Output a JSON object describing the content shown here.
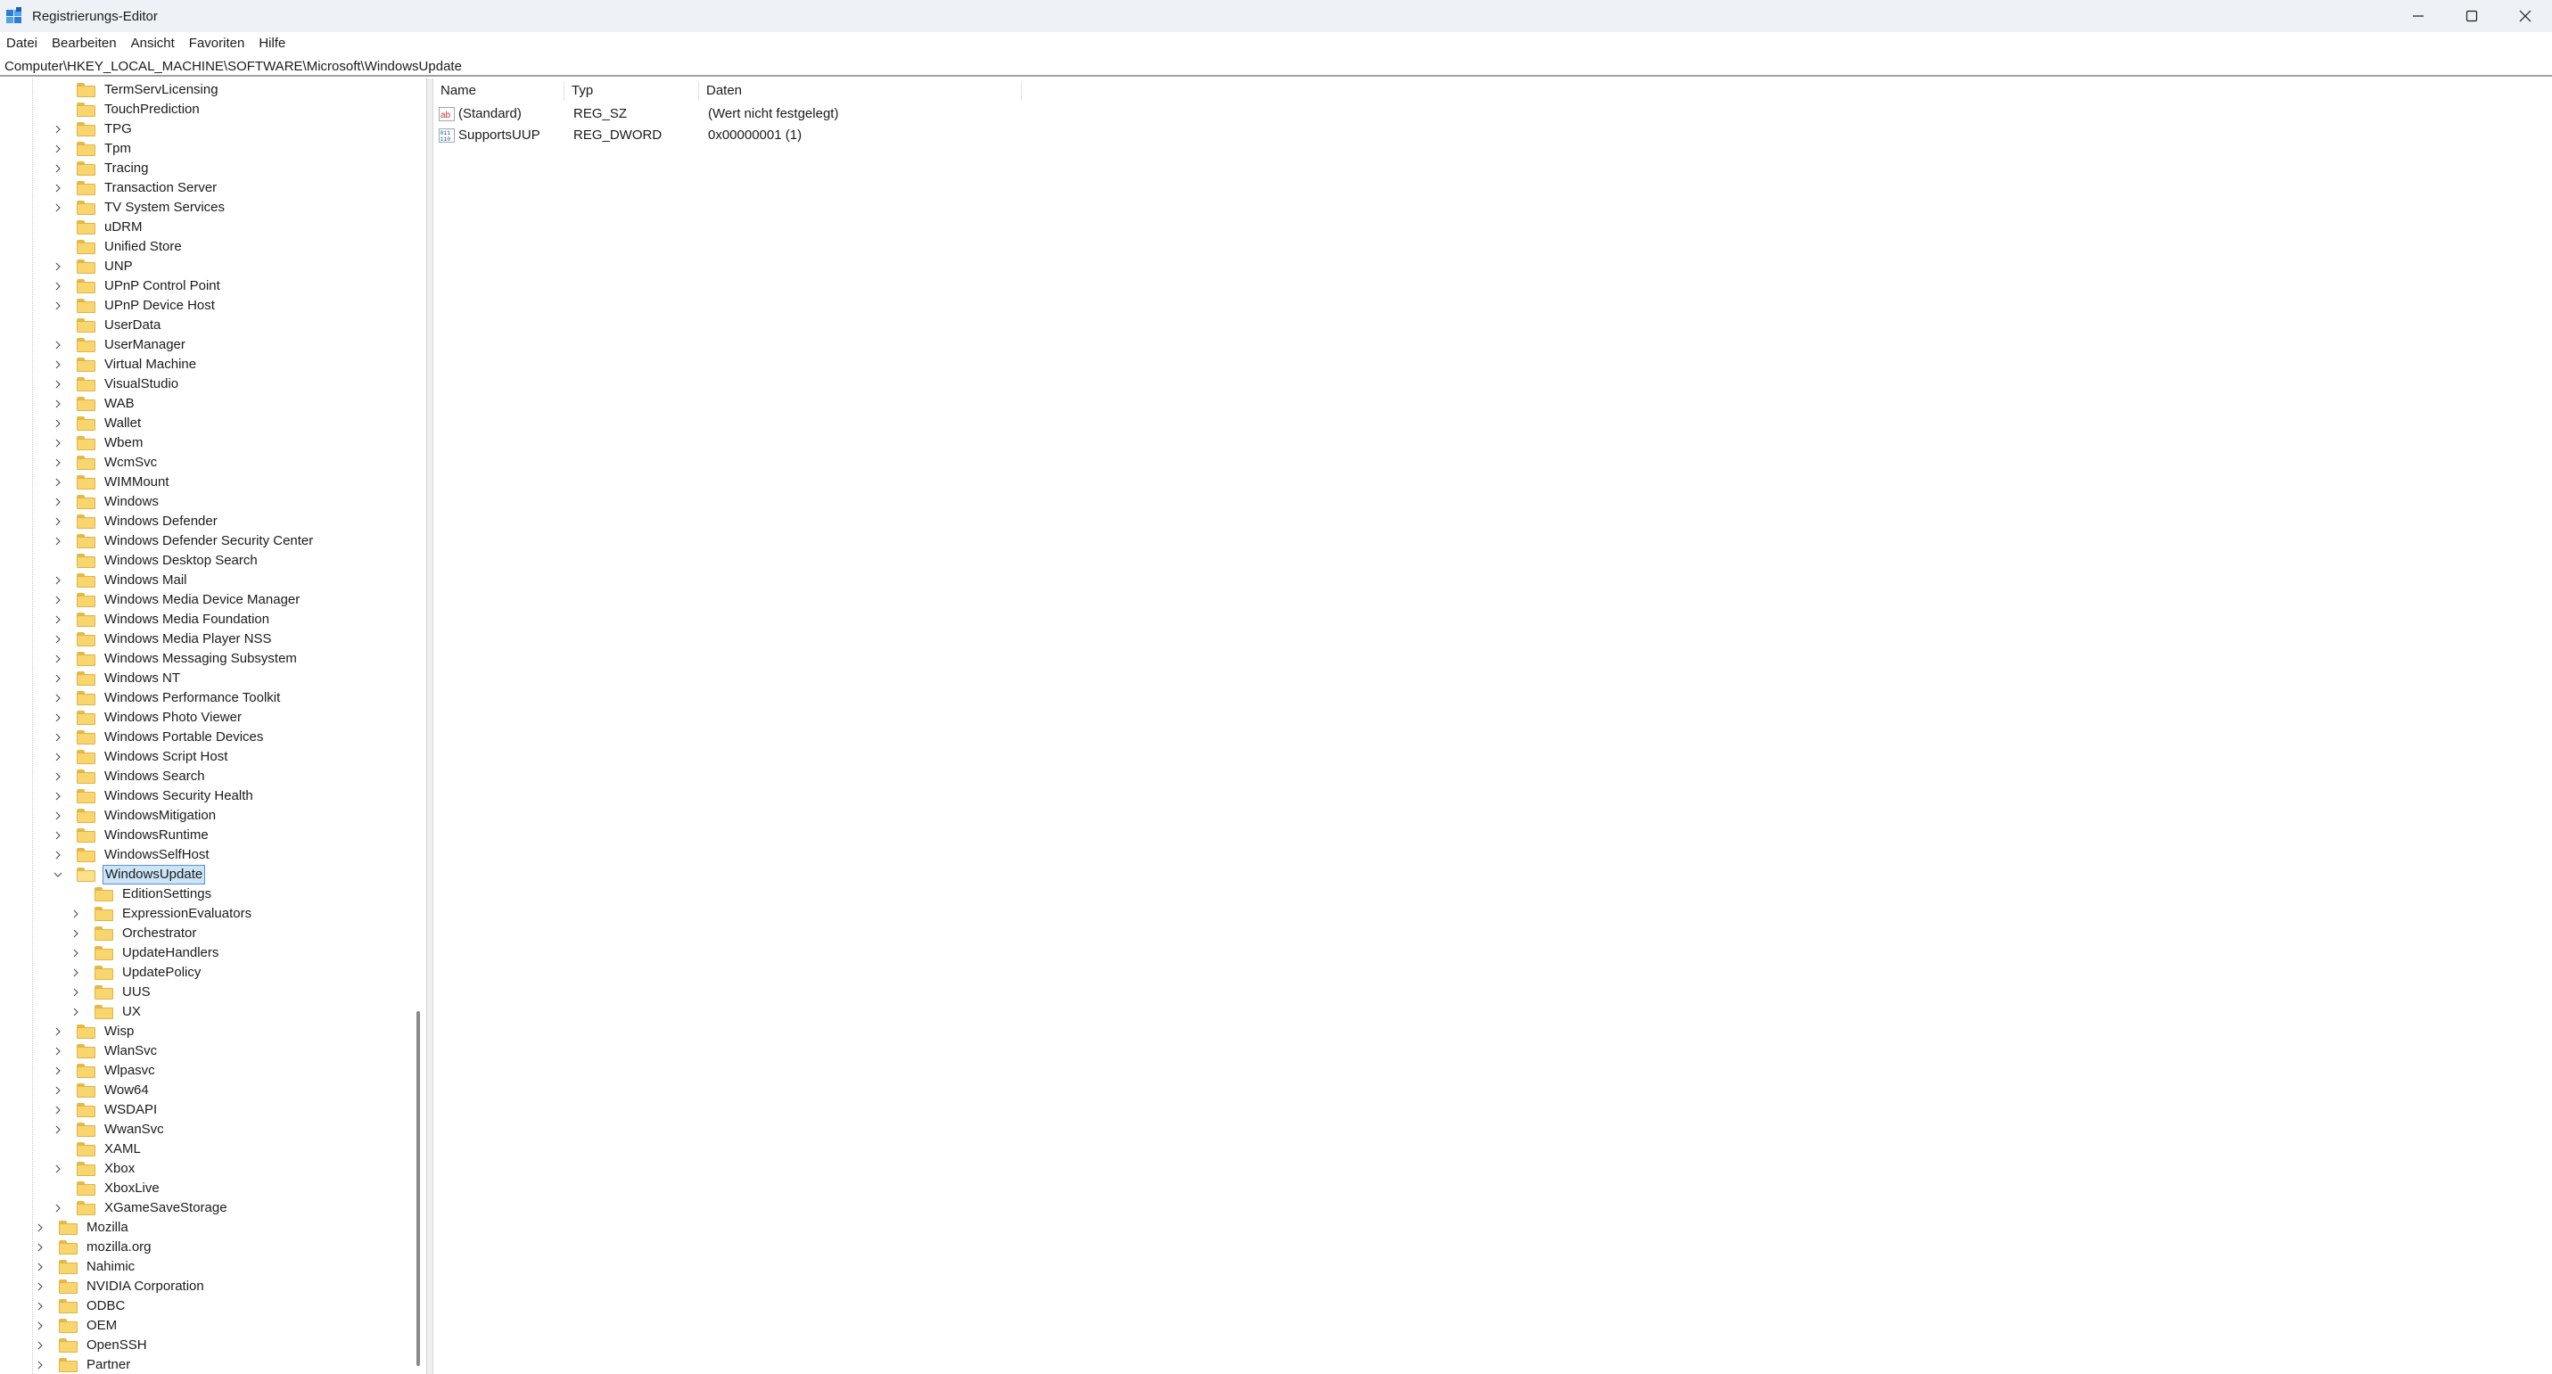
{
  "window": {
    "title": "Registrierungs-Editor",
    "controls": [
      "minimize-icon",
      "maximize-icon",
      "close-icon"
    ]
  },
  "menu": [
    "Datei",
    "Bearbeiten",
    "Ansicht",
    "Favoriten",
    "Hilfe"
  ],
  "address": "Computer\\HKEY_LOCAL_MACHINE\\SOFTWARE\\Microsoft\\WindowsUpdate",
  "tree": [
    {
      "label": "TermServLicensing",
      "depth": 1,
      "exp": false
    },
    {
      "label": "TouchPrediction",
      "depth": 1,
      "exp": false
    },
    {
      "label": "TPG",
      "depth": 1,
      "exp": true
    },
    {
      "label": "Tpm",
      "depth": 1,
      "exp": true
    },
    {
      "label": "Tracing",
      "depth": 1,
      "exp": true
    },
    {
      "label": "Transaction Server",
      "depth": 1,
      "exp": true
    },
    {
      "label": "TV System Services",
      "depth": 1,
      "exp": true
    },
    {
      "label": "uDRM",
      "depth": 1,
      "exp": false
    },
    {
      "label": "Unified Store",
      "depth": 1,
      "exp": false
    },
    {
      "label": "UNP",
      "depth": 1,
      "exp": true
    },
    {
      "label": "UPnP Control Point",
      "depth": 1,
      "exp": true
    },
    {
      "label": "UPnP Device Host",
      "depth": 1,
      "exp": true
    },
    {
      "label": "UserData",
      "depth": 1,
      "exp": false
    },
    {
      "label": "UserManager",
      "depth": 1,
      "exp": true
    },
    {
      "label": "Virtual Machine",
      "depth": 1,
      "exp": true
    },
    {
      "label": "VisualStudio",
      "depth": 1,
      "exp": true
    },
    {
      "label": "WAB",
      "depth": 1,
      "exp": true
    },
    {
      "label": "Wallet",
      "depth": 1,
      "exp": true
    },
    {
      "label": "Wbem",
      "depth": 1,
      "exp": true
    },
    {
      "label": "WcmSvc",
      "depth": 1,
      "exp": true
    },
    {
      "label": "WIMMount",
      "depth": 1,
      "exp": true
    },
    {
      "label": "Windows",
      "depth": 1,
      "exp": true
    },
    {
      "label": "Windows Defender",
      "depth": 1,
      "exp": true
    },
    {
      "label": "Windows Defender Security Center",
      "depth": 1,
      "exp": true
    },
    {
      "label": "Windows Desktop Search",
      "depth": 1,
      "exp": false
    },
    {
      "label": "Windows Mail",
      "depth": 1,
      "exp": true
    },
    {
      "label": "Windows Media Device Manager",
      "depth": 1,
      "exp": true
    },
    {
      "label": "Windows Media Foundation",
      "depth": 1,
      "exp": true
    },
    {
      "label": "Windows Media Player NSS",
      "depth": 1,
      "exp": true
    },
    {
      "label": "Windows Messaging Subsystem",
      "depth": 1,
      "exp": true
    },
    {
      "label": "Windows NT",
      "depth": 1,
      "exp": true
    },
    {
      "label": "Windows Performance Toolkit",
      "depth": 1,
      "exp": true
    },
    {
      "label": "Windows Photo Viewer",
      "depth": 1,
      "exp": true
    },
    {
      "label": "Windows Portable Devices",
      "depth": 1,
      "exp": true
    },
    {
      "label": "Windows Script Host",
      "depth": 1,
      "exp": true
    },
    {
      "label": "Windows Search",
      "depth": 1,
      "exp": true
    },
    {
      "label": "Windows Security Health",
      "depth": 1,
      "exp": true
    },
    {
      "label": "WindowsMitigation",
      "depth": 1,
      "exp": true
    },
    {
      "label": "WindowsRuntime",
      "depth": 1,
      "exp": true
    },
    {
      "label": "WindowsSelfHost",
      "depth": 1,
      "exp": true
    },
    {
      "label": "WindowsUpdate",
      "depth": 1,
      "exp": "open",
      "selected": true
    },
    {
      "label": "EditionSettings",
      "depth": 2,
      "exp": false
    },
    {
      "label": "ExpressionEvaluators",
      "depth": 2,
      "exp": true
    },
    {
      "label": "Orchestrator",
      "depth": 2,
      "exp": true
    },
    {
      "label": "UpdateHandlers",
      "depth": 2,
      "exp": true
    },
    {
      "label": "UpdatePolicy",
      "depth": 2,
      "exp": true
    },
    {
      "label": "UUS",
      "depth": 2,
      "exp": true
    },
    {
      "label": "UX",
      "depth": 2,
      "exp": true
    },
    {
      "label": "Wisp",
      "depth": 1,
      "exp": true
    },
    {
      "label": "WlanSvc",
      "depth": 1,
      "exp": true
    },
    {
      "label": "Wlpasvc",
      "depth": 1,
      "exp": true
    },
    {
      "label": "Wow64",
      "depth": 1,
      "exp": true
    },
    {
      "label": "WSDAPI",
      "depth": 1,
      "exp": true
    },
    {
      "label": "WwanSvc",
      "depth": 1,
      "exp": true
    },
    {
      "label": "XAML",
      "depth": 1,
      "exp": false
    },
    {
      "label": "Xbox",
      "depth": 1,
      "exp": true
    },
    {
      "label": "XboxLive",
      "depth": 1,
      "exp": false
    },
    {
      "label": "XGameSaveStorage",
      "depth": 1,
      "exp": true
    },
    {
      "label": "Mozilla",
      "depth": 0,
      "exp": true
    },
    {
      "label": "mozilla.org",
      "depth": 0,
      "exp": true
    },
    {
      "label": "Nahimic",
      "depth": 0,
      "exp": true
    },
    {
      "label": "NVIDIA Corporation",
      "depth": 0,
      "exp": true
    },
    {
      "label": "ODBC",
      "depth": 0,
      "exp": true
    },
    {
      "label": "OEM",
      "depth": 0,
      "exp": true
    },
    {
      "label": "OpenSSH",
      "depth": 0,
      "exp": true
    },
    {
      "label": "Partner",
      "depth": 0,
      "exp": true
    }
  ],
  "columns": {
    "name": "Name",
    "type": "Typ",
    "data": "Daten"
  },
  "values": [
    {
      "name": "(Standard)",
      "type": "REG_SZ",
      "data": "(Wert nicht festgelegt)",
      "icon": "string-value-icon"
    },
    {
      "name": "SupportsUUP",
      "type": "REG_DWORD",
      "data": "0x00000001 (1)",
      "icon": "binary-value-icon"
    }
  ],
  "colors": {
    "titlebar": "#eef1f5",
    "folder": "#f9d56e",
    "selection": "#cce4f7",
    "selection_border": "#5a8fd6"
  }
}
